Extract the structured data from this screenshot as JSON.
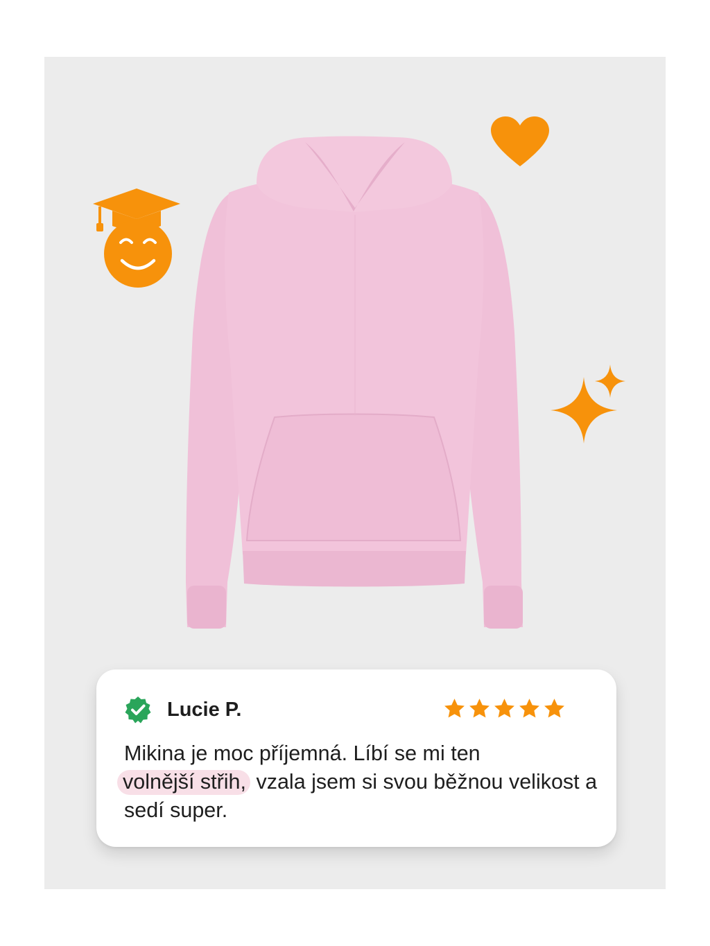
{
  "product": {
    "image": "pink-hoodie",
    "color": "#f2c4db"
  },
  "decorations": {
    "color": "#f7920b",
    "icons": [
      "graduation-cap-smiley-icon",
      "heart-icon",
      "sparkle-icon"
    ]
  },
  "review": {
    "name": "Lucie P.",
    "verified_icon": "verified-check-icon",
    "rating": 5,
    "rating_max": 5,
    "text_before": "Mikina je moc příjemná. Líbí se mi ten",
    "highlight": "volnější střih,",
    "text_after": "vzala jsem si svou běžnou velikost a sedí super.",
    "highlight_color": "#f8dfe7"
  }
}
